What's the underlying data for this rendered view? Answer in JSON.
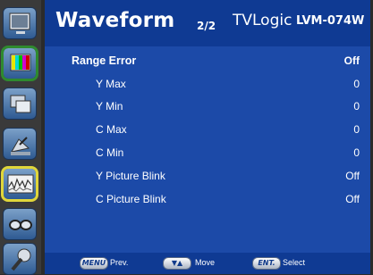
{
  "header": {
    "title": "Waveform",
    "page": "2/2",
    "brand": "TVLogic",
    "model": "LVM-074W"
  },
  "sidebar": {
    "items": [
      {
        "icon": "monitor-icon"
      },
      {
        "icon": "color-bars-icon",
        "state": "selected-green"
      },
      {
        "icon": "windows-icon"
      },
      {
        "icon": "satellite-dish-icon"
      },
      {
        "icon": "waveform-icon",
        "state": "selected-yellow"
      },
      {
        "icon": "glasses-icon"
      },
      {
        "icon": "wrench-icon"
      }
    ]
  },
  "menu": {
    "rows": [
      {
        "label": "Range Error",
        "value": "Off"
      },
      {
        "label": "Y Max",
        "value": "0"
      },
      {
        "label": "Y Min",
        "value": "0"
      },
      {
        "label": "C Max",
        "value": "0"
      },
      {
        "label": "C Min",
        "value": "0"
      },
      {
        "label": "Y Picture Blink",
        "value": "Off"
      },
      {
        "label": "C Picture Blink",
        "value": "Off"
      }
    ]
  },
  "footer": {
    "hints": [
      {
        "key": "MENU",
        "action": "Prev."
      },
      {
        "key": "▼▲",
        "action": "Move"
      },
      {
        "key": "ENT.",
        "action": "Select"
      }
    ]
  },
  "colors": {
    "panel_bg": "#1c4aa8",
    "header_bg": "#0f3a93",
    "sidebar_bg": "#3a3a3a",
    "selected_green": "#2f8a2f",
    "selected_yellow": "#e0d63a"
  }
}
